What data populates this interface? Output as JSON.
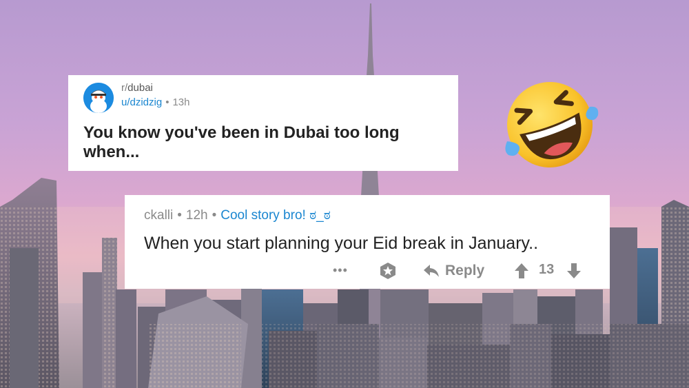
{
  "post": {
    "subreddit_prefix": "r/",
    "subreddit_name": "dubai",
    "author": "u/dzidzig",
    "separator": "•",
    "time": "13h",
    "title": "You know you've been in Dubai too long when..."
  },
  "comment": {
    "author": "ckalli",
    "separator": "•",
    "time": "12h",
    "flair": "Cool story bro! ಠ_ಠ",
    "body": "When you start planning your Eid break in January..",
    "actions": {
      "more_icon": "more-dots-icon",
      "award_icon": "award-icon",
      "reply_label": "Reply",
      "reply_icon": "reply-arrow-icon",
      "upvote_icon": "arrow-up-icon",
      "vote_count": "13",
      "downvote_icon": "arrow-down-icon"
    }
  },
  "emoji": {
    "icon": "rolling-on-floor-laughing-emoji"
  },
  "colors": {
    "link_blue": "#1a86d0",
    "text_dark": "#222222",
    "text_muted": "#8a8a8a",
    "card_bg": "#ffffff",
    "avatar_bg": "#1c8be0"
  }
}
